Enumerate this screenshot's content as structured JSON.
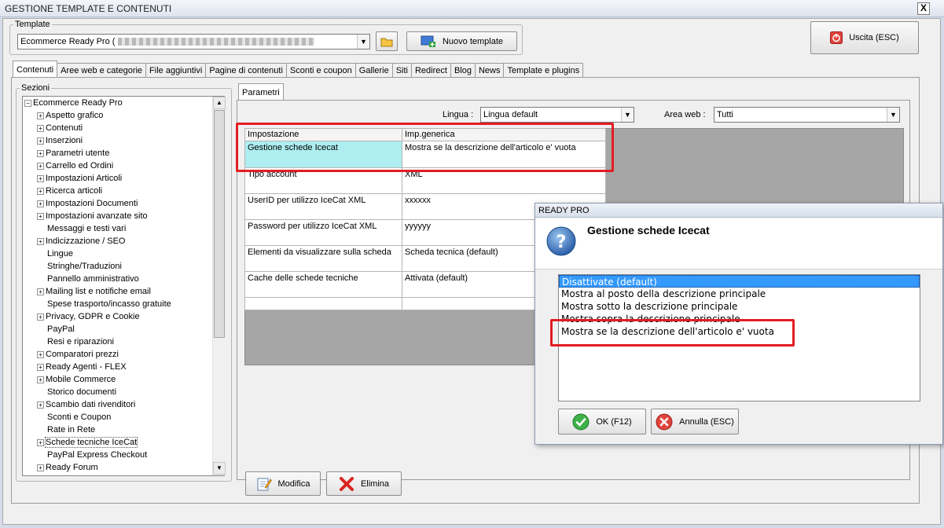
{
  "window": {
    "title": "GESTIONE TEMPLATE E CONTENUTI",
    "close_glyph": "X"
  },
  "template_group": {
    "legend": "Template",
    "selected": "Ecommerce Ready Pro (",
    "new_template_label": "Nuovo template"
  },
  "exit_button": {
    "label": "Uscita (ESC)"
  },
  "tabs": [
    {
      "label": "Contenuti",
      "active": true
    },
    {
      "label": "Aree web e categorie"
    },
    {
      "label": "File aggiuntivi"
    },
    {
      "label": "Pagine di contenuti"
    },
    {
      "label": "Sconti e coupon"
    },
    {
      "label": "Gallerie"
    },
    {
      "label": "Siti"
    },
    {
      "label": "Redirect"
    },
    {
      "label": "Blog"
    },
    {
      "label": "News"
    },
    {
      "label": "Template e plugins"
    }
  ],
  "sections": {
    "legend": "Sezioni",
    "root": "Ecommerce Ready Pro",
    "items": [
      {
        "label": "Aspetto grafico",
        "expandable": true
      },
      {
        "label": "Contenuti",
        "expandable": true
      },
      {
        "label": "Inserzioni",
        "expandable": true
      },
      {
        "label": "Parametri utente",
        "expandable": true
      },
      {
        "label": "Carrello ed Ordini",
        "expandable": true
      },
      {
        "label": "Impostazioni Articoli",
        "expandable": true
      },
      {
        "label": "Ricerca articoli",
        "expandable": true
      },
      {
        "label": "Impostazioni Documenti",
        "expandable": true
      },
      {
        "label": "Impostazioni avanzate sito",
        "expandable": true
      },
      {
        "label": "Messaggi e testi vari",
        "expandable": false
      },
      {
        "label": "Indicizzazione / SEO",
        "expandable": true
      },
      {
        "label": "Lingue",
        "expandable": false
      },
      {
        "label": "Stringhe/Traduzioni",
        "expandable": false
      },
      {
        "label": "Pannello amministrativo",
        "expandable": false
      },
      {
        "label": "Mailing list e notifiche email",
        "expandable": true
      },
      {
        "label": "Spese trasporto/incasso gratuite",
        "expandable": false
      },
      {
        "label": "Privacy, GDPR e Cookie",
        "expandable": true
      },
      {
        "label": "PayPal",
        "expandable": false
      },
      {
        "label": "Resi e riparazioni",
        "expandable": false
      },
      {
        "label": "Comparatori prezzi",
        "expandable": true
      },
      {
        "label": "Ready Agenti - FLEX",
        "expandable": true
      },
      {
        "label": "Mobile Commerce",
        "expandable": true
      },
      {
        "label": "Storico documenti",
        "expandable": false
      },
      {
        "label": "Scambio dati rivenditori",
        "expandable": true
      },
      {
        "label": "Sconti e Coupon",
        "expandable": false
      },
      {
        "label": "Rate in Rete",
        "expandable": false
      },
      {
        "label": "Schede tecniche IceCat",
        "expandable": true,
        "selected": true
      },
      {
        "label": "PayPal Express Checkout",
        "expandable": false
      },
      {
        "label": "Ready Forum",
        "expandable": true
      }
    ]
  },
  "params": {
    "tab_label": "Parametri",
    "lingua_label": "Lingua :",
    "lingua_value": "Lingua default",
    "area_label": "Area web :",
    "area_value": "Tutti",
    "grid": {
      "headers": [
        "Impostazione",
        "Imp.generica"
      ],
      "rows": [
        [
          "Gestione schede Icecat",
          "Mostra se la descrizione dell'articolo e' vuota"
        ],
        [
          "Tipo account",
          "XML"
        ],
        [
          "UserID per utilizzo IceCat XML",
          "xxxxxx"
        ],
        [
          "Password per utilizzo IceCat XML",
          "yyyyyy"
        ],
        [
          "Elementi da visualizzare sulla scheda",
          "Scheda tecnica (default)"
        ],
        [
          "Cache delle schede tecniche",
          "Attivata (default)"
        ]
      ]
    },
    "edit_label": "Modifica",
    "delete_label": "Elimina"
  },
  "dialog": {
    "title": "READY PRO",
    "heading": "Gestione schede Icecat",
    "options": [
      "Disattivate (default)",
      "Mostra al posto della descrizione principale",
      "Mostra sotto la descrizione principale",
      "Mostra sopra la descrizione principale",
      "Mostra se la descrizione dell'articolo e' vuota"
    ],
    "selected_index": 0,
    "ok_label": "OK (F12)",
    "cancel_label": "Annulla (ESC)"
  },
  "colors": {
    "highlight_cell": "#aeeef0",
    "annotation_red": "#e21d23",
    "selection_blue": "#3399ff"
  }
}
